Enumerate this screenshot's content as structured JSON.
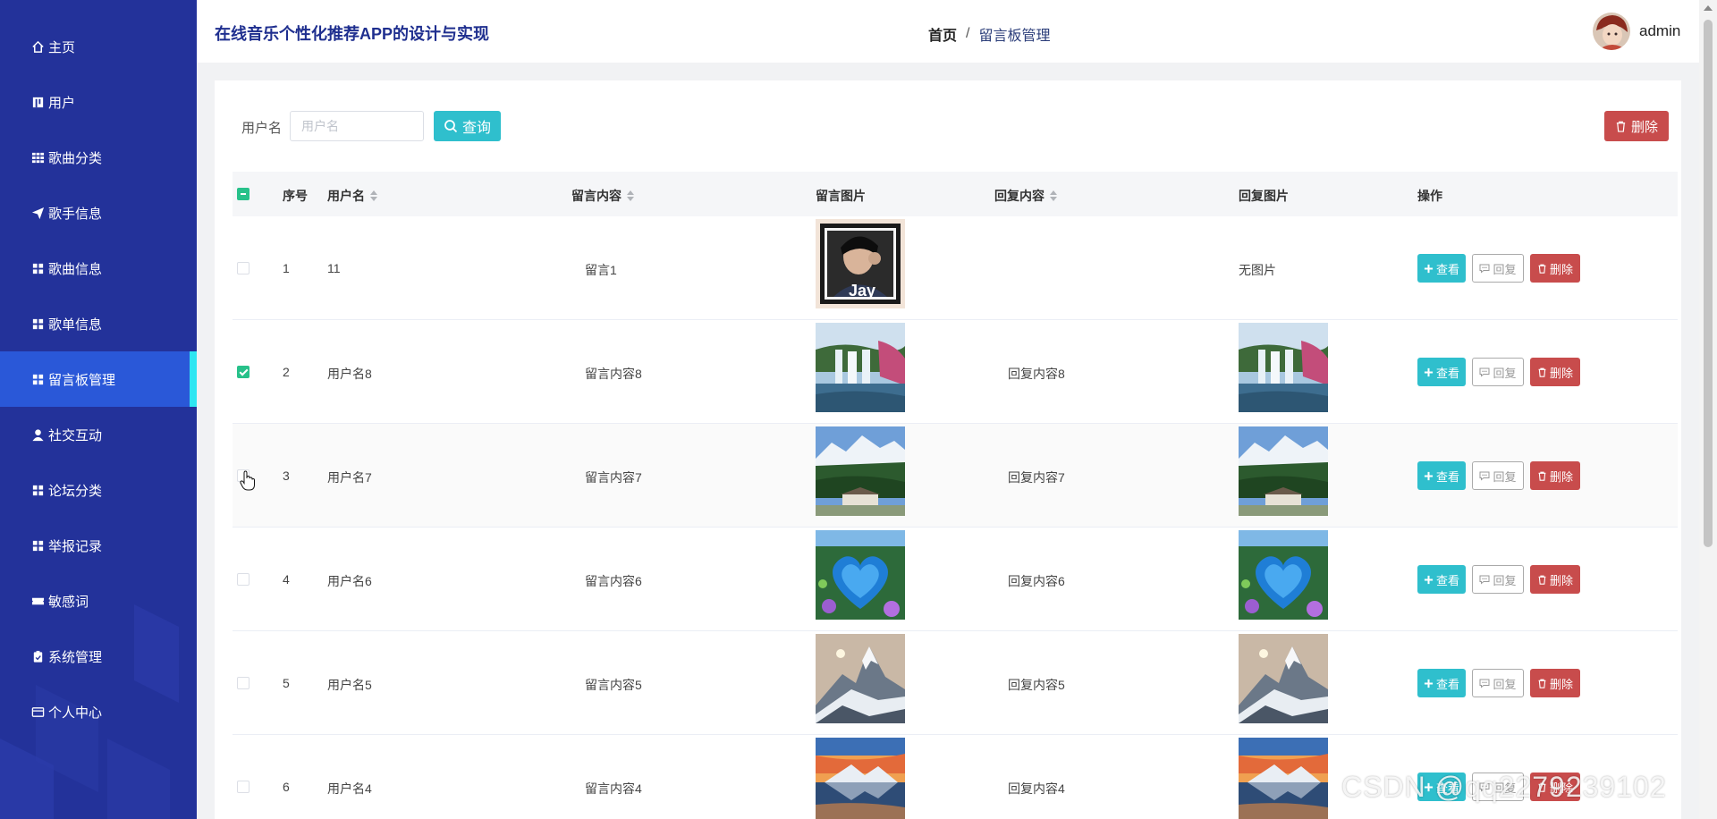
{
  "app": {
    "title": "在线音乐个性化推荐APP的设计与实现"
  },
  "breadcrumb": {
    "home": "首页",
    "separator": "/",
    "current": "留言板管理"
  },
  "user": {
    "name": "admin"
  },
  "sidebar": {
    "items": [
      {
        "label": "主页",
        "icon": "home-icon"
      },
      {
        "label": "用户",
        "icon": "user-book-icon"
      },
      {
        "label": "歌曲分类",
        "icon": "grid-icon"
      },
      {
        "label": "歌手信息",
        "icon": "send-icon"
      },
      {
        "label": "歌曲信息",
        "icon": "grid-icon"
      },
      {
        "label": "歌单信息",
        "icon": "grid-icon"
      },
      {
        "label": "留言板管理",
        "icon": "grid-icon",
        "active": true
      },
      {
        "label": "社交互动",
        "icon": "person-icon"
      },
      {
        "label": "论坛分类",
        "icon": "grid-icon"
      },
      {
        "label": "举报记录",
        "icon": "grid-icon"
      },
      {
        "label": "敏感词",
        "icon": "ticket-icon"
      },
      {
        "label": "系统管理",
        "icon": "clipboard-icon"
      },
      {
        "label": "个人中心",
        "icon": "card-icon"
      }
    ]
  },
  "search": {
    "label": "用户名",
    "placeholder": "用户名",
    "value": "",
    "button": "查询"
  },
  "toolbar": {
    "delete_label": "删除"
  },
  "table": {
    "headers": {
      "index": "序号",
      "username": "用户名",
      "content": "留言内容",
      "image": "留言图片",
      "reply": "回复内容",
      "reply_image": "回复图片",
      "actions": "操作"
    },
    "actions": {
      "view": "查看",
      "reply": "回复",
      "delete": "删除"
    },
    "no_image_text": "无图片",
    "rows": [
      {
        "index": "1",
        "username": "11",
        "content": "留言1",
        "image": "portrait-jay",
        "reply": "",
        "reply_image": "",
        "checked": false
      },
      {
        "index": "2",
        "username": "用户名8",
        "content": "留言内容8",
        "image": "waterfall",
        "reply": "回复内容8",
        "reply_image": "waterfall",
        "checked": true
      },
      {
        "index": "3",
        "username": "用户名7",
        "content": "留言内容7",
        "image": "snow-mountain-village",
        "reply": "回复内容7",
        "reply_image": "snow-mountain-village",
        "checked": false
      },
      {
        "index": "4",
        "username": "用户名6",
        "content": "留言内容6",
        "image": "heart-lake",
        "reply": "回复内容6",
        "reply_image": "heart-lake",
        "checked": false
      },
      {
        "index": "5",
        "username": "用户名5",
        "content": "留言内容5",
        "image": "mountain-peak",
        "reply": "回复内容5",
        "reply_image": "mountain-peak",
        "checked": false
      },
      {
        "index": "6",
        "username": "用户名4",
        "content": "留言内容4",
        "image": "sunset-mountain",
        "reply": "回复内容4",
        "reply_image": "sunset-mountain",
        "checked": false
      }
    ]
  },
  "watermark": "CSDN @qq2279239102",
  "colors": {
    "sidebar_bg": "#23329a",
    "sidebar_active": "#2a58d8",
    "accent_cyan": "#2fbfcd",
    "danger": "#c84c4c",
    "check_green": "#27c18a",
    "title_blue": "#1f2f8f"
  }
}
